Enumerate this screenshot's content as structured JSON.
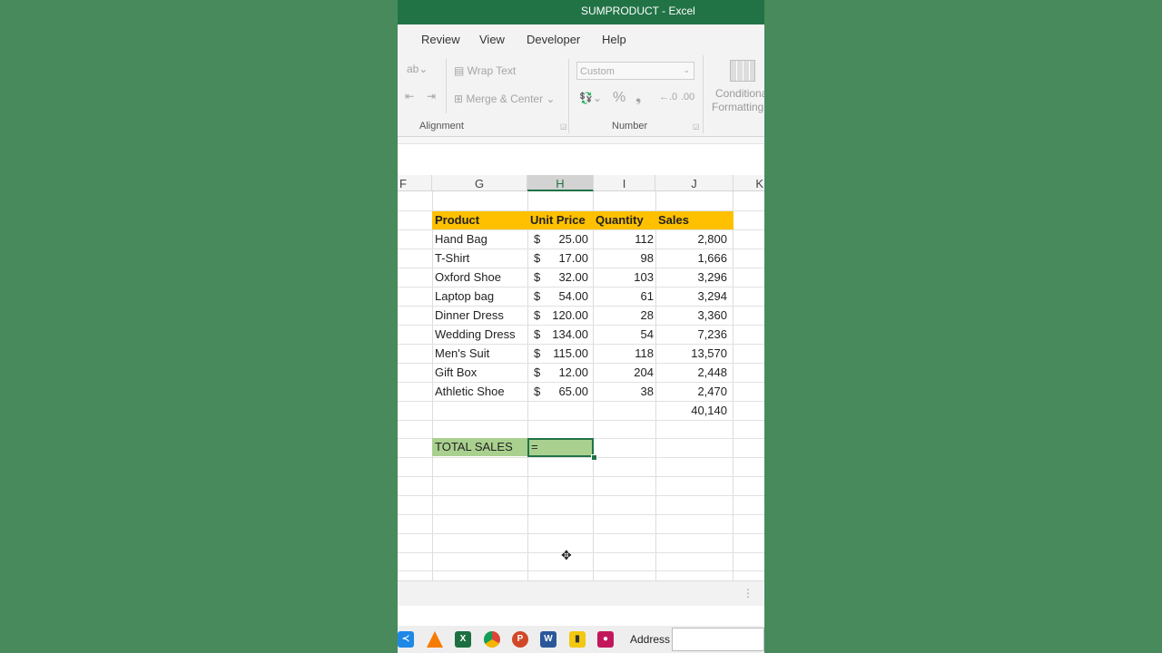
{
  "window": {
    "title": "SUMPRODUCT  -  Excel"
  },
  "menu": [
    "Review",
    "View",
    "Developer",
    "Help"
  ],
  "ribbon": {
    "wrap_text": "Wrap Text",
    "merge_center": "Merge & Center",
    "number_format": "Custom",
    "percent": "%",
    "comma": "❟",
    "conditional": "Conditional",
    "formatting": "Formatting",
    "group_alignment": "Alignment",
    "group_number": "Number"
  },
  "columns": [
    "F",
    "G",
    "H",
    "I",
    "J",
    "K"
  ],
  "table": {
    "headers": [
      "Product",
      "Unit Price",
      "Quantity",
      "Sales"
    ],
    "rows": [
      {
        "product": "Hand Bag",
        "cur": "$",
        "price": "25.00",
        "qty": "112",
        "sales": "2,800"
      },
      {
        "product": "T-Shirt",
        "cur": "$",
        "price": "17.00",
        "qty": "98",
        "sales": "1,666"
      },
      {
        "product": "Oxford Shoe",
        "cur": "$",
        "price": "32.00",
        "qty": "103",
        "sales": "3,296"
      },
      {
        "product": "Laptop bag",
        "cur": "$",
        "price": "54.00",
        "qty": "61",
        "sales": "3,294"
      },
      {
        "product": "Dinner Dress",
        "cur": "$",
        "price": "120.00",
        "qty": "28",
        "sales": "3,360"
      },
      {
        "product": "Wedding Dress",
        "cur": "$",
        "price": "134.00",
        "qty": "54",
        "sales": "7,236"
      },
      {
        "product": "Men's Suit",
        "cur": "$",
        "price": "115.00",
        "qty": "118",
        "sales": "13,570"
      },
      {
        "product": "Gift Box",
        "cur": "$",
        "price": "12.00",
        "qty": "204",
        "sales": "2,448"
      },
      {
        "product": "Athletic Shoe",
        "cur": "$",
        "price": "65.00",
        "qty": "38",
        "sales": "2,470"
      }
    ],
    "sum": "40,140"
  },
  "total": {
    "label": "TOTAL SALES",
    "input": "="
  },
  "taskbar": {
    "icons": [
      "vscode-icon",
      "vlc-icon",
      "excel-icon",
      "chrome-icon",
      "powerpoint-icon",
      "word-icon",
      "powerbi-icon",
      "screen-recorder-icon"
    ],
    "address_label": "Address"
  },
  "colors": {
    "accent": "#217346",
    "header_fill": "#ffc000",
    "total_fill": "#a9d08e"
  }
}
